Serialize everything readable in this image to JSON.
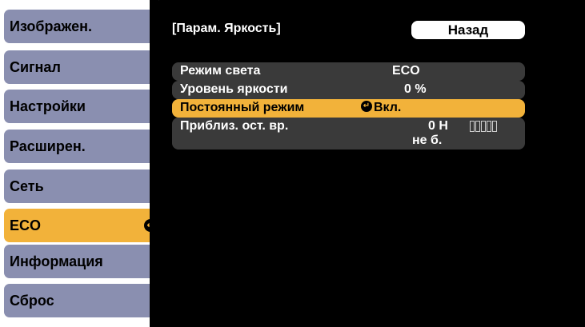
{
  "menu": {
    "items": [
      {
        "label": "Изображен."
      },
      {
        "label": "Сигнал"
      },
      {
        "label": "Настройки"
      },
      {
        "label": "Расширен."
      },
      {
        "label": "Сеть"
      },
      {
        "label": "ECO",
        "active": true
      },
      {
        "label": "Информация"
      },
      {
        "label": "Сброс"
      }
    ]
  },
  "panel": {
    "title": "[Парам. Яркость]",
    "back_label": "Назад",
    "rows": [
      {
        "label": "Режим света",
        "value": "ECO"
      },
      {
        "label": "Уровень яркости",
        "value": "0 %"
      },
      {
        "label": "Постоянный режим",
        "value": "Вкл.",
        "selected": true
      },
      {
        "label": "Приблиз. ост. вр.",
        "value": "0 H",
        "value2": "не б.",
        "bar_segments": 5
      }
    ]
  },
  "colors": {
    "menu_bg": "#8a8fb0",
    "accent": "#f2b23a",
    "panel_bg": "#000000",
    "row_bg": "#3a3a3a"
  }
}
